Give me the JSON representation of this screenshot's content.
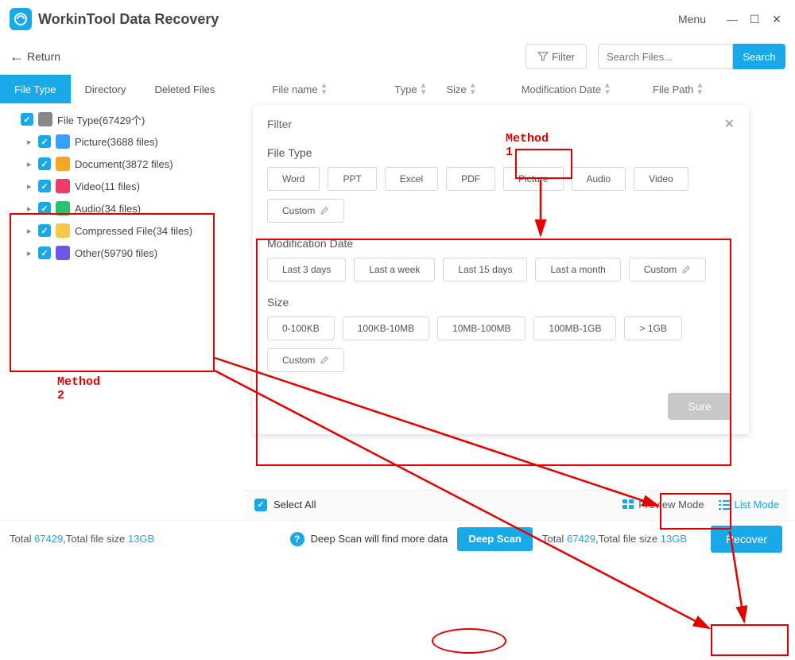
{
  "app": {
    "title": "WorkinTool Data Recovery",
    "menu": "Menu"
  },
  "top": {
    "return": "Return",
    "filter": "Filter",
    "search_placeholder": "Search Files...",
    "search_btn": "Search"
  },
  "annotations": {
    "method1": "Method 1",
    "method2": "Method 2"
  },
  "tabs": [
    "File Type",
    "Directory",
    "Deleted Files"
  ],
  "active_tab": 0,
  "columns": [
    "File name",
    "Type",
    "Size",
    "Modification Date",
    "File Path"
  ],
  "tree": {
    "root": {
      "label": "File Type(67429个)",
      "icon_color": "#888"
    },
    "children": [
      {
        "label": "Picture(3688 files)",
        "icon_color": "#3aa0ff"
      },
      {
        "label": "Document(3872 files)",
        "icon_color": "#f6a726"
      },
      {
        "label": "Video(11 files)",
        "icon_color": "#ec3d6a"
      },
      {
        "label": "Audio(34 files)",
        "icon_color": "#27c36a"
      },
      {
        "label": "Compressed File(34 files)",
        "icon_color": "#f7c948"
      },
      {
        "label": "Other(59790 files)",
        "icon_color": "#6f57e6"
      }
    ]
  },
  "filter_panel": {
    "title": "Filter",
    "sections": {
      "type": {
        "label": "File Type",
        "chips": [
          "Word",
          "PPT",
          "Excel",
          "PDF",
          "Picture",
          "Audio",
          "Video",
          "Custom"
        ]
      },
      "date": {
        "label": "Modification Date",
        "chips": [
          "Last 3 days",
          "Last a week",
          "Last 15 days",
          "Last a month",
          "Custom"
        ]
      },
      "size": {
        "label": "Size",
        "chips": [
          "0-100KB",
          "100KB-10MB",
          "10MB-100MB",
          "100MB-1GB",
          "> 1GB",
          "Custom"
        ]
      }
    },
    "sure": "Sure"
  },
  "options_bar": {
    "select_all": "Select All",
    "preview_mode": "Preview Mode",
    "list_mode": "List Mode"
  },
  "status": {
    "total_count": "67429",
    "total_size": "13GB",
    "left_prefix": "Total ",
    "left_mid": ",Total file size ",
    "deep_hint": "Deep Scan will find more data",
    "deep_btn": "Deep Scan",
    "right_prefix": "Total ",
    "right_mid": ",Total file size ",
    "recover": "Recover"
  }
}
